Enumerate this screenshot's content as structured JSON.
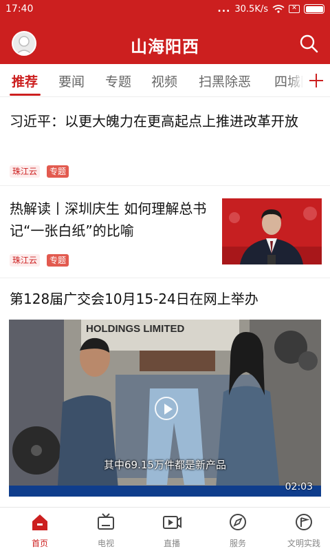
{
  "status_bar": {
    "time": "17:40",
    "dots": "...",
    "network_speed": "30.5K/s"
  },
  "header": {
    "title": "山海阳西",
    "avatar_icon": "user-avatar-icon",
    "search_icon": "search-icon"
  },
  "tabs": [
    {
      "label": "推荐",
      "active": true
    },
    {
      "label": "要闻",
      "active": false
    },
    {
      "label": "专题",
      "active": false
    },
    {
      "label": "视频",
      "active": false
    },
    {
      "label": "扫黑除恶",
      "active": false
    },
    {
      "label": "四城同创",
      "active": false
    }
  ],
  "tabs_add_icon": "plus-icon",
  "feed": [
    {
      "headline": "习近平：以更大魄力在更高起点上推进改革开放",
      "source": "珠江云",
      "topic_badge": "专题"
    },
    {
      "headline": "热解读丨深圳庆生 如何理解总书记“一张白纸”的比喻",
      "source": "珠江云",
      "topic_badge": "专题",
      "thumbnail": "news-photo"
    },
    {
      "headline": "第128届广交会10月15-24日在网上举办",
      "video": {
        "caption": "其中69.15万件都是新产品",
        "duration": "02:03",
        "sign_text": "HOLDINGS LIMITED"
      }
    }
  ],
  "bottom_nav": [
    {
      "label": "首页",
      "icon": "home-icon",
      "active": true
    },
    {
      "label": "电视",
      "icon": "tv-icon",
      "active": false
    },
    {
      "label": "直播",
      "icon": "live-video-icon",
      "active": false
    },
    {
      "label": "服务",
      "icon": "compass-icon",
      "active": false
    },
    {
      "label": "文明实践",
      "icon": "flag-circle-icon",
      "active": false
    }
  ],
  "colors": {
    "brand": "#cc1f1f",
    "tag_bg": "#fdecec",
    "topic_badge": "#e25a4f",
    "nav_inactive": "#888888"
  }
}
